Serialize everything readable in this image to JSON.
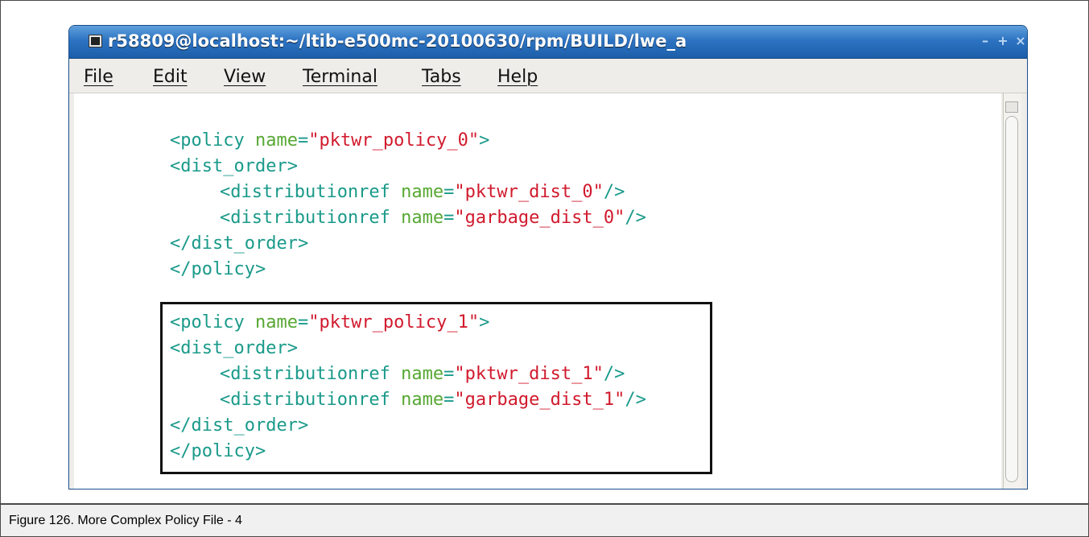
{
  "window": {
    "title": "r58809@localhost:~/ltib-e500mc-20100630/rpm/BUILD/lwe_a",
    "buttons": {
      "minimize": "–",
      "maximize": "+",
      "close": "×"
    }
  },
  "menu": [
    {
      "label": "File"
    },
    {
      "label": "Edit"
    },
    {
      "label": "View"
    },
    {
      "label": "Terminal"
    },
    {
      "label": "Tabs"
    },
    {
      "label": "Help"
    }
  ],
  "code": {
    "block1": {
      "l1": {
        "open": "<policy ",
        "attr": "name",
        "eq": "=",
        "val": "\"pktwr_policy_0\"",
        "close": ">"
      },
      "l2": {
        "text": "<dist_order>"
      },
      "l3": {
        "open": "<distributionref ",
        "attr": "name",
        "eq": "=",
        "val": "\"pktwr_dist_0\"",
        "close": "/>"
      },
      "l4": {
        "open": "<distributionref ",
        "attr": "name",
        "eq": "=",
        "val": "\"garbage_dist_0\"",
        "close": "/>"
      },
      "l5": {
        "text": "</dist_order>"
      },
      "l6": {
        "text": "</policy>"
      }
    },
    "block2": {
      "l1": {
        "open": "<policy ",
        "attr": "name",
        "eq": "=",
        "val": "\"pktwr_policy_1\"",
        "close": ">"
      },
      "l2": {
        "text": "<dist_order>"
      },
      "l3": {
        "open": "<distributionref ",
        "attr": "name",
        "eq": "=",
        "val": "\"pktwr_dist_1\"",
        "close": "/>"
      },
      "l4": {
        "open": "<distributionref ",
        "attr": "name",
        "eq": "=",
        "val": "\"garbage_dist_1\"",
        "close": "/>"
      },
      "l5": {
        "text": "</dist_order>"
      },
      "l6": {
        "text": "</policy>"
      }
    }
  },
  "caption": "Figure 126. More Complex Policy File - 4",
  "colors": {
    "tag": "#1a9a8a",
    "attr": "#57a833",
    "value": "#d11a2d",
    "titlebar": "#2c73c2"
  }
}
